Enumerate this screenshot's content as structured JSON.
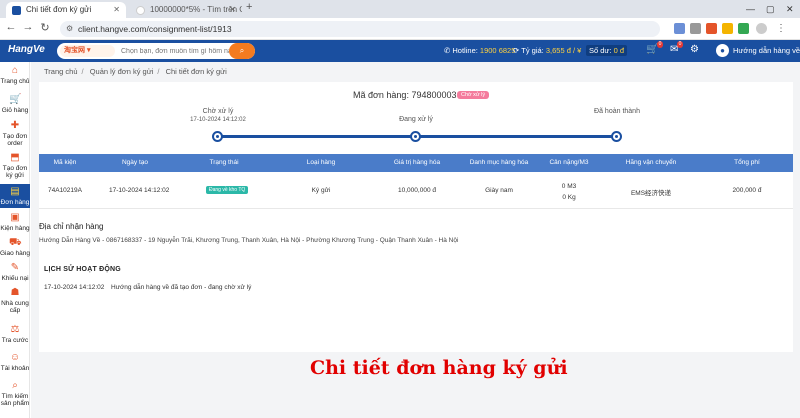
{
  "browser": {
    "tabs": [
      {
        "title": "Chi tiết đơn ký gửi",
        "active": true
      },
      {
        "title": "10000000*5% - Tìm trên Googl...",
        "active": false
      }
    ],
    "url": "client.hangve.com/consignment-list/1913"
  },
  "header": {
    "logo": "HangVe",
    "search_tag": "淘宝网",
    "search_placeholder": "Chọn bạn, đơn muốn tìm gì hôm nay",
    "hotline_label": "Hotline:",
    "hotline_value": "1900 6825",
    "rate_label": "Tỷ giá:",
    "rate_value": "3,655 đ / ¥",
    "balance_label": "Số dư:",
    "balance_value": "0 đ",
    "cart_count": "0",
    "message_count": "0",
    "user_name": "Hướng dẫn hàng về"
  },
  "sidebar": {
    "items": [
      {
        "label": "Trang chủ",
        "icon": "home-icon"
      },
      {
        "label": "Giỏ hàng",
        "icon": "cart-icon"
      },
      {
        "label": "Tạo đơn order",
        "icon": "create-order-icon"
      },
      {
        "label": "Tạo đơn ký gửi",
        "icon": "consign-icon"
      },
      {
        "label": "Đơn hàng",
        "icon": "orders-icon"
      },
      {
        "label": "Kiện hàng",
        "icon": "package-icon"
      },
      {
        "label": "Giao hàng",
        "icon": "delivery-icon"
      },
      {
        "label": "Khiếu nại",
        "icon": "complaint-icon"
      },
      {
        "label": "Nhà cung cấp",
        "icon": "supplier-icon"
      },
      {
        "label": "Tra cước",
        "icon": "fee-icon"
      },
      {
        "label": "Tài khoản",
        "icon": "account-icon"
      },
      {
        "label": "Tìm kiếm sản phẩm",
        "icon": "product-search-icon"
      }
    ]
  },
  "breadcrumb": [
    "Trang chủ",
    "Quản lý đơn ký gửi",
    "Chi tiết đơn ký gửi"
  ],
  "order": {
    "code_label": "Mã đơn hàng: 794800003",
    "status": "Chờ xử lý",
    "steps": [
      {
        "label": "Chờ xử lý",
        "date": "17-10-2024 14:12:02"
      },
      {
        "label": "Đang xử lý",
        "date": ""
      },
      {
        "label": "Đã hoàn thành",
        "date": ""
      }
    ]
  },
  "table": {
    "columns": [
      "Mã kiện",
      "Ngày tạo",
      "Trạng thái",
      "Loại hàng",
      "Giá trị hàng hóa",
      "Danh mục hàng hóa",
      "Cân nặng/M3",
      "Hãng vận chuyển",
      "Tổng phí"
    ],
    "row": {
      "code": "74A10219A",
      "created": "17-10-2024 14:12:02",
      "status": "Đang về kho TQ",
      "type": "Ký gửi",
      "value": "10,000,000 đ",
      "category": "Giày nam",
      "volume": "0 M3",
      "weight": "0 Kg",
      "carrier": "EMS经济快递",
      "total": "200,000 đ"
    }
  },
  "address": {
    "title": "Địa chỉ nhận hàng",
    "text": "Hướng Dẫn Hàng Về - 0867168337 - 19 Nguyễn Trãi, Khương Trung, Thanh Xuân, Hà Nội - Phường Khương Trung - Quận Thanh Xuân - Hà Nội"
  },
  "history": {
    "title": "LỊCH SỬ HOẠT ĐỘNG",
    "time": "17-10-2024 14:12:02",
    "text": "Hướng dẫn hàng về đã tạo đơn - đang chờ xử lý"
  },
  "caption": "Chi tiết đơn hàng ký gửi",
  "colors": {
    "brand": "#1a4fa0",
    "accent": "#f47b20",
    "table_header": "#4a7cc9",
    "caption": "#e10000"
  }
}
